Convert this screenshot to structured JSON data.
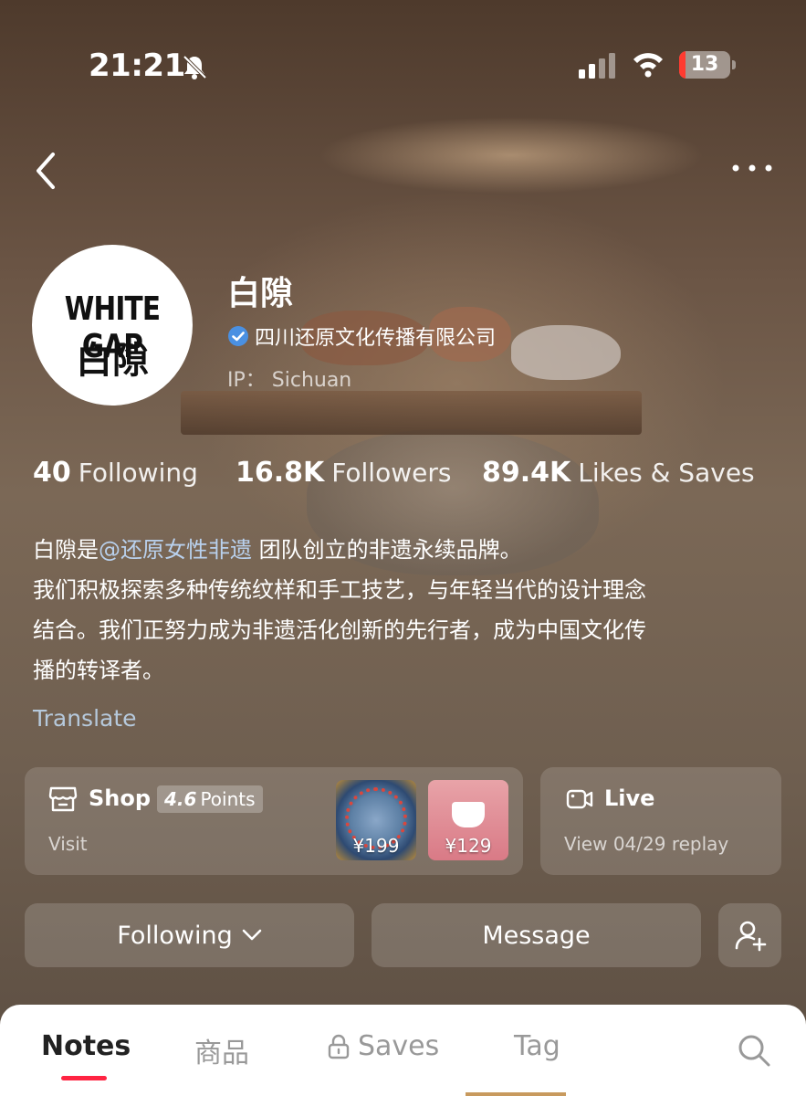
{
  "status_bar": {
    "time": "21:21",
    "battery_level": "13",
    "icons": [
      "bell-slash-icon",
      "cellular-signal-icon",
      "wifi-icon",
      "battery-icon"
    ]
  },
  "nav": {
    "back_icon": "chevron-left-icon",
    "more_icon": "ellipsis-icon"
  },
  "profile": {
    "avatar_line1": "WHITE GAP",
    "avatar_line2": "白隙",
    "name": "白隙",
    "verified_icon": "verified-check-icon",
    "company": "四川还原文化传播有限公司",
    "ip_label": "IP：",
    "ip_value": "Sichuan"
  },
  "stats": [
    {
      "value": "40",
      "label": "Following"
    },
    {
      "value": "16.8K",
      "label": "Followers"
    },
    {
      "value": "89.4K",
      "label": "Likes & Saves"
    }
  ],
  "bio": {
    "line1_prefix": "白隙是",
    "mention": "@还原女性非遗",
    "line1_suffix": " 团队创立的非遗永续品牌。",
    "line2": "我们积极探索多种传统纹样和手工技艺，与年轻当代的设计理念",
    "line3": "结合。我们正努力成为非遗活化创新的先行者，成为中国文化传",
    "line4": "播的转译者。"
  },
  "translate_label": "Translate",
  "shop": {
    "title": "Shop",
    "points_value": "4.6",
    "points_label": "Points",
    "sub": "Visit",
    "products": [
      {
        "price": "¥199"
      },
      {
        "price": "¥129"
      }
    ]
  },
  "live": {
    "title": "Live",
    "sub": "View 04/29 replay"
  },
  "actions": {
    "following": "Following",
    "message": "Message"
  },
  "tabs": [
    {
      "label": "Notes",
      "active": true
    },
    {
      "label": "商品"
    },
    {
      "label": "Saves",
      "locked": true
    },
    {
      "label": "Tag"
    }
  ],
  "colors": {
    "accent": "#ff2442",
    "link": "#b9d1ee",
    "verified": "#4a90e2"
  }
}
